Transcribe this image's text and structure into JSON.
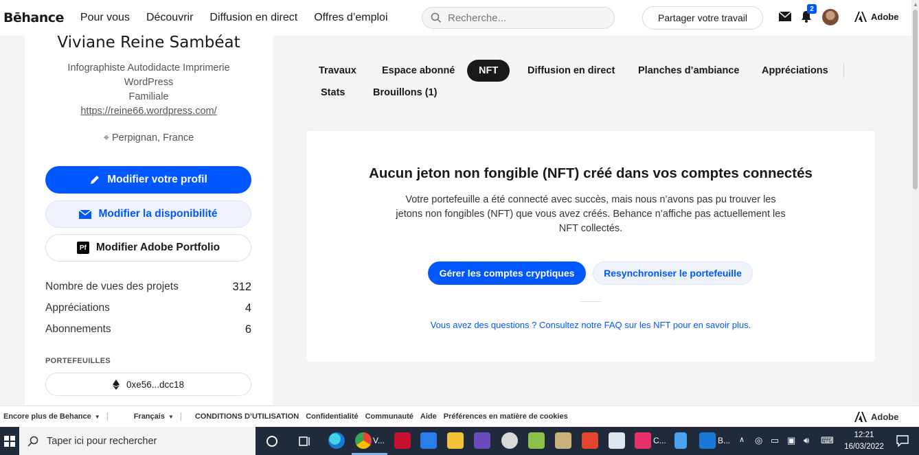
{
  "nav": {
    "logo": "Bēhance",
    "links": [
      "Pour vous",
      "Découvrir",
      "Diffusion en direct",
      "Offres d’emploi"
    ],
    "search_placeholder": "Recherche...",
    "share_label": "Partager votre travail",
    "notif_count": "2",
    "adobe_label": "Adobe"
  },
  "profile": {
    "name": "Viviane Reine Sambéat",
    "bio_line1": "Infographiste Autodidacte Imprimerie",
    "bio_line2": "WordPress",
    "bio_line3": "Familiale",
    "website": "https://reine66.wordpress.com/",
    "location": "Perpignan, France",
    "edit_profile": "Modifier votre profil",
    "edit_availability": "Modifier la disponibilité",
    "edit_portfolio": "Modifier Adobe Portfolio",
    "stats": [
      {
        "label": "Nombre de vues des projets",
        "value": "312"
      },
      {
        "label": "Appréciations",
        "value": "4"
      },
      {
        "label": "Abonnements",
        "value": "6"
      }
    ],
    "wallets_label": "PORTEFEUILLES",
    "wallet_address": "0xe56...dcc18"
  },
  "tabs": [
    {
      "label": "Travaux",
      "active": false
    },
    {
      "label": "Espace abonné",
      "active": false
    },
    {
      "label": "NFT",
      "active": true
    },
    {
      "label": "Diffusion en direct",
      "active": false
    },
    {
      "label": "Planches d’ambiance",
      "active": false
    },
    {
      "label": "Appréciations",
      "active": false
    },
    {
      "label": "Stats",
      "active": false
    },
    {
      "label": "Brouillons (1)",
      "active": false
    }
  ],
  "nft_card": {
    "title": "Aucun jeton non fongible (NFT) créé dans vos comptes connectés",
    "description": "Votre portefeuille a été connecté avec succès, mais nous n’avons pas pu trouver les jetons non fongibles (NFT) que vous avez créés. Behance n’affiche pas actuellement les NFT collectés.",
    "manage_button": "Gérer les comptes cryptiques",
    "resync_button": "Resynchroniser le portefeuille",
    "faq_link": "Vous avez des questions ? Consultez notre FAQ sur les NFT pour en savoir plus."
  },
  "footer": {
    "more": "Encore plus de Behance",
    "language": "Français",
    "links": [
      "CONDITIONS D’UTILISATION",
      "Confidentialité",
      "Communauté",
      "Aide",
      "Préférences en matière de cookies"
    ],
    "adobe_label": "Adobe"
  },
  "taskbar": {
    "search_placeholder": "Taper ici pour rechercher",
    "chrome_label": "V...",
    "cc_label": "C...",
    "mail_label": "B...",
    "time": "12:21",
    "date": "16/03/2022"
  },
  "colors": {
    "brand_blue": "#0057ff",
    "taskbar": "#1f2a3a"
  }
}
